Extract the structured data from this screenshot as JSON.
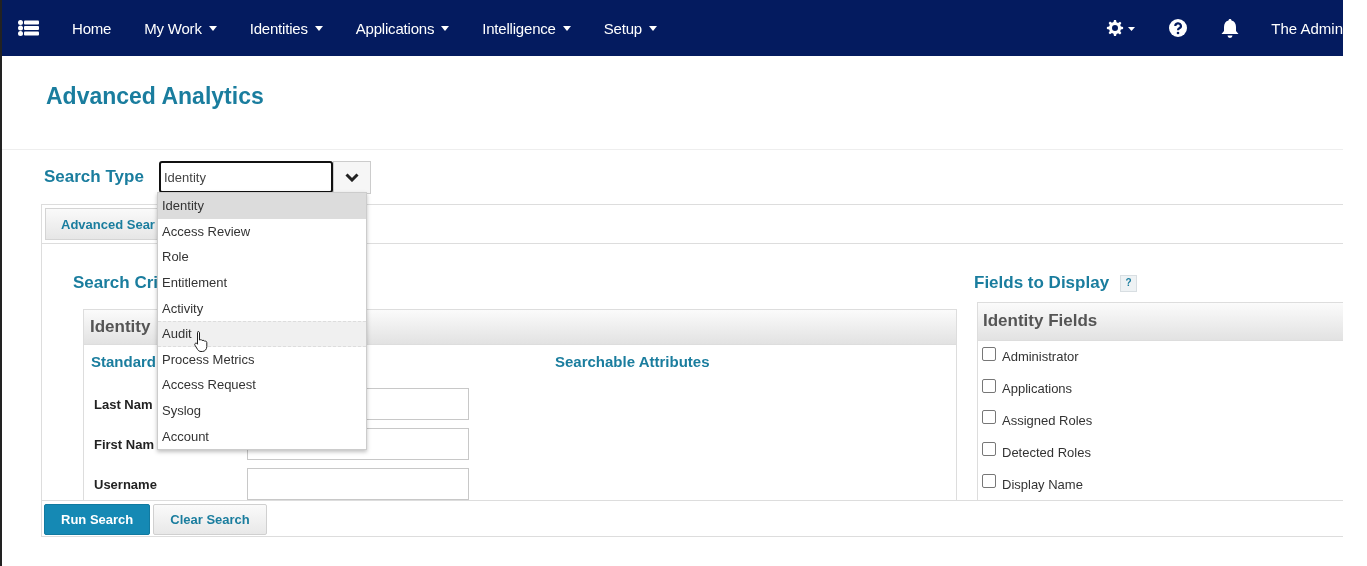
{
  "nav": {
    "items": [
      {
        "label": "Home",
        "has_menu": false
      },
      {
        "label": "My Work",
        "has_menu": true
      },
      {
        "label": "Identities",
        "has_menu": true
      },
      {
        "label": "Applications",
        "has_menu": true
      },
      {
        "label": "Intelligence",
        "has_menu": true
      },
      {
        "label": "Setup",
        "has_menu": true
      }
    ],
    "user": "The Admin"
  },
  "title": "Advanced Analytics",
  "search_type": {
    "label": "Search Type",
    "value": "Identity",
    "options": [
      {
        "label": "Identity",
        "selected": true,
        "hovered": false
      },
      {
        "label": "Access Review",
        "selected": false,
        "hovered": false
      },
      {
        "label": "Role",
        "selected": false,
        "hovered": false
      },
      {
        "label": "Entitlement",
        "selected": false,
        "hovered": false
      },
      {
        "label": "Activity",
        "selected": false,
        "hovered": false
      },
      {
        "label": "Audit",
        "selected": false,
        "hovered": true
      },
      {
        "label": "Process Metrics",
        "selected": false,
        "hovered": false
      },
      {
        "label": "Access Request",
        "selected": false,
        "hovered": false
      },
      {
        "label": "Syslog",
        "selected": false,
        "hovered": false
      },
      {
        "label": "Account",
        "selected": false,
        "hovered": false
      }
    ]
  },
  "tab": "Advanced Sear",
  "criteria": {
    "heading": "Search Cri",
    "section_title": "Identity",
    "standard_heading": "Standard",
    "searchable_heading": "Searchable Attributes",
    "fields": [
      {
        "label": "Last Nam"
      },
      {
        "label": "First Nam"
      },
      {
        "label": "Username"
      }
    ]
  },
  "fields_to_display": {
    "heading": "Fields to Display",
    "help": "?",
    "group_title": "Identity Fields",
    "options": [
      {
        "label": "Administrator",
        "checked": false
      },
      {
        "label": "Applications",
        "checked": false
      },
      {
        "label": "Assigned Roles",
        "checked": false
      },
      {
        "label": "Detected Roles",
        "checked": false
      },
      {
        "label": "Display Name",
        "checked": false
      }
    ]
  },
  "buttons": [
    {
      "label": "Run Search",
      "kind": "primary"
    },
    {
      "label": "Clear Search",
      "kind": "secondary"
    }
  ]
}
